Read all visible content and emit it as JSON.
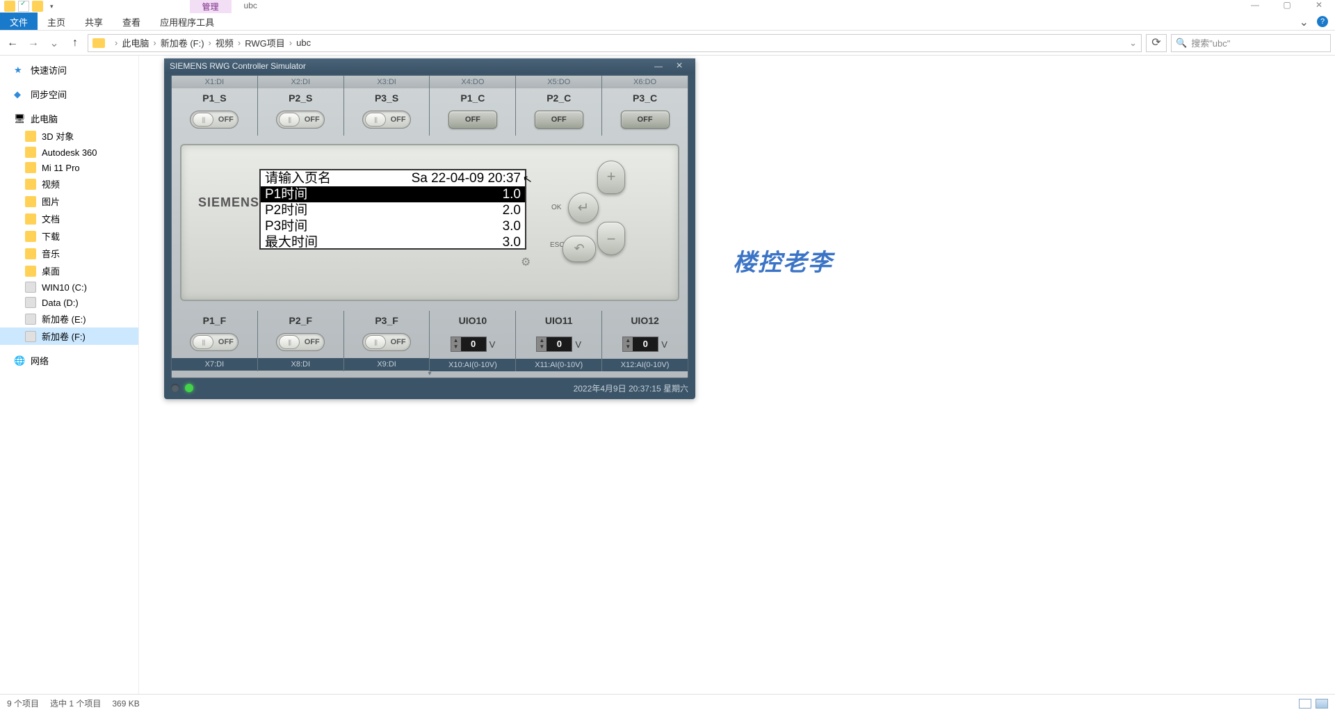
{
  "titlebar": {
    "manage_tab": "管理",
    "folder_tab": "ubc"
  },
  "ribbon": {
    "file": "文件",
    "tabs": [
      "主页",
      "共享",
      "查看",
      "应用程序工具"
    ]
  },
  "address": {
    "crumbs": [
      "此电脑",
      "新加卷 (F:)",
      "视频",
      "RWG项目",
      "ubc"
    ],
    "search_placeholder": "搜索\"ubc\""
  },
  "sidebar": {
    "quick": "快速访问",
    "sync": "同步空间",
    "pc": "此电脑",
    "items": [
      "3D 对象",
      "Autodesk 360",
      "Mi 11 Pro",
      "视频",
      "图片",
      "文档",
      "下载",
      "音乐",
      "桌面",
      "WIN10 (C:)",
      "Data (D:)",
      "新加卷 (E:)",
      "新加卷 (F:)"
    ],
    "network": "网络"
  },
  "sim": {
    "title": "SIEMENS RWG Controller Simulator",
    "top_ports": [
      "X1:DI",
      "X2:DI",
      "X3:DI",
      "X4:DO",
      "X5:DO",
      "X6:DO"
    ],
    "top_names": [
      "P1_S",
      "P2_S",
      "P3_S",
      "P1_C",
      "P2_C",
      "P3_C"
    ],
    "off": "OFF",
    "logo": "SIEMENS",
    "lcd": {
      "r0l": "请输入页名",
      "r0r": "Sa 22-04-09 20:37",
      "r1l": "P1时间",
      "r1r": "1.0",
      "r2l": "P2时间",
      "r2r": "2.0",
      "r3l": "P3时间",
      "r3r": "3.0",
      "r4l": "最大时间",
      "r4r": "3.0"
    },
    "ok": "OK",
    "esc": "ESC",
    "bot_names": [
      "P1_F",
      "P2_F",
      "P3_F",
      "UIO10",
      "UIO11",
      "UIO12"
    ],
    "bot_ports": [
      "X7:DI",
      "X8:DI",
      "X9:DI",
      "X10:AI(0-10V)",
      "X11:AI(0-10V)",
      "X12:AI(0-10V)"
    ],
    "uio_val": "0",
    "uio_unit": "V",
    "clock": "2022年4月9日  20:37:15  星期六"
  },
  "watermark": "楼控老李",
  "status": {
    "count": "9 个项目",
    "sel": "选中 1 个项目",
    "size": "369 KB"
  }
}
